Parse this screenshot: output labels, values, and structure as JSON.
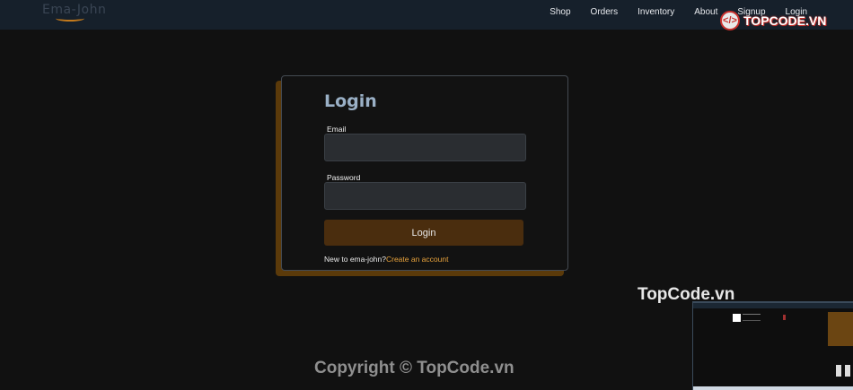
{
  "brand": {
    "logo_text": "Ema-John"
  },
  "nav": {
    "items": [
      {
        "label": "Shop"
      },
      {
        "label": "Orders"
      },
      {
        "label": "Inventory"
      },
      {
        "label": "About"
      },
      {
        "label": "Signup"
      },
      {
        "label": "Login"
      }
    ]
  },
  "watermark": {
    "badge_icon": "</>",
    "badge_text": "TOPCODE.VN",
    "text": "TopCode.vn"
  },
  "login_form": {
    "title": "Login",
    "email_label": "Email",
    "email_value": "",
    "password_label": "Password",
    "password_value": "",
    "submit_label": "Login",
    "signup_prompt": "New to ema-john?",
    "signup_link": "Create an account"
  },
  "footer": {
    "copyright": "Copyright © TopCode.vn"
  },
  "colors": {
    "background": "#111111",
    "navbar": "#16202b",
    "accent": "#e8a33c",
    "button": "#4a2d0e",
    "card_shadow": "#5b3a0a"
  }
}
